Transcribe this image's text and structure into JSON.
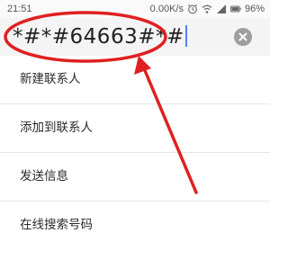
{
  "status_bar": {
    "time": "21:51",
    "network_speed": "0.00K/s",
    "battery": "96%"
  },
  "dialer": {
    "input_value": "*#*#64663#*#",
    "clear_icon": "close-icon"
  },
  "menu": {
    "items": [
      {
        "label": "新建联系人"
      },
      {
        "label": "添加到联系人"
      },
      {
        "label": "发送信息"
      },
      {
        "label": "在线搜索号码"
      }
    ]
  },
  "annotation": {
    "color": "#e02020"
  }
}
